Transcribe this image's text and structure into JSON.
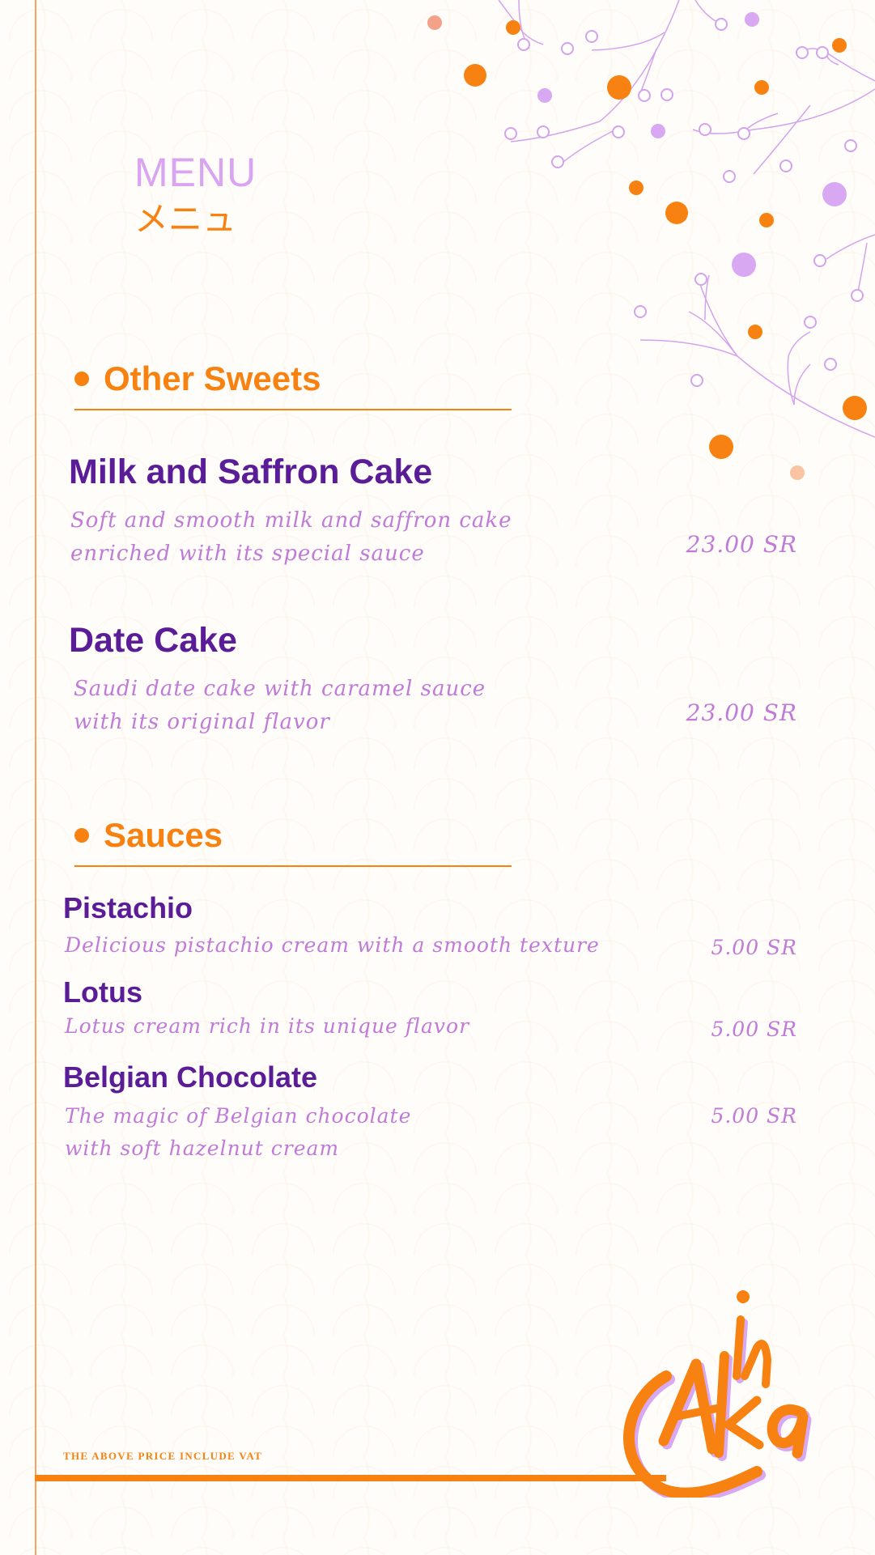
{
  "header": {
    "title": "MENU",
    "subtitle_jp": "メニュ"
  },
  "sections": [
    {
      "title": "Other Sweets",
      "items": [
        {
          "name": "Milk and Saffron Cake",
          "description": "Soft and smooth milk and saffron cake\nenriched with its special sauce",
          "price": "23.00 SR"
        },
        {
          "name": "Date Cake",
          "description": "Saudi date cake with caramel sauce\nwith its original flavor",
          "price": "23.00 SR"
        }
      ]
    },
    {
      "title": "Sauces",
      "items": [
        {
          "name": "Pistachio",
          "description": "Delicious pistachio cream with a smooth texture",
          "price": "5.00 SR"
        },
        {
          "name": "Lotus",
          "description": "Lotus cream rich in its unique flavor",
          "price": "5.00 SR"
        },
        {
          "name": "Belgian Chocolate",
          "description": "The magic of Belgian chocolate\nwith soft hazelnut cream",
          "price": "5.00 SR"
        }
      ]
    }
  ],
  "footer": {
    "vat_note": "THE ABOVE PRICE INCLUDE VAT"
  },
  "logo": {
    "text": "Akin"
  },
  "colors": {
    "accent_orange": "#f78211",
    "lilac": "#d9a4f0",
    "purple": "#5a1d97",
    "description": "#c07ad8"
  }
}
